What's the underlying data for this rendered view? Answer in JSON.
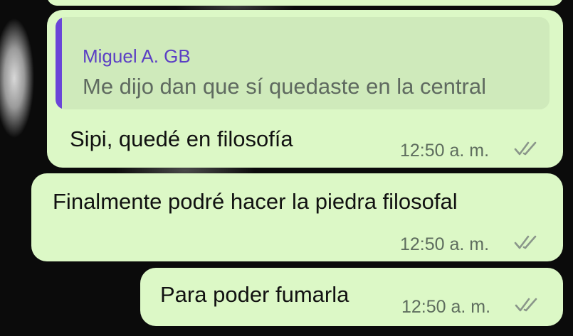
{
  "messages": [
    {
      "quote": {
        "author": "Miguel A. GB",
        "text": "Me dijo dan que sí quedaste en la central"
      },
      "text": "Sipi, quedé en filosofía",
      "time": "12:50 a. m.",
      "status_icon": "double-check-icon"
    },
    {
      "text": "Finalmente podré hacer la piedra filosofal",
      "time": "12:50 a. m.",
      "status_icon": "double-check-icon"
    },
    {
      "text": "Para poder fumarla",
      "time": "12:50 a. m.",
      "status_icon": "double-check-icon"
    }
  ],
  "colors": {
    "bubble": "#dcf8c6",
    "quote_bg": "#cfeabb",
    "quote_bar": "#6a45d8",
    "quote_author": "#5b3fc4"
  }
}
